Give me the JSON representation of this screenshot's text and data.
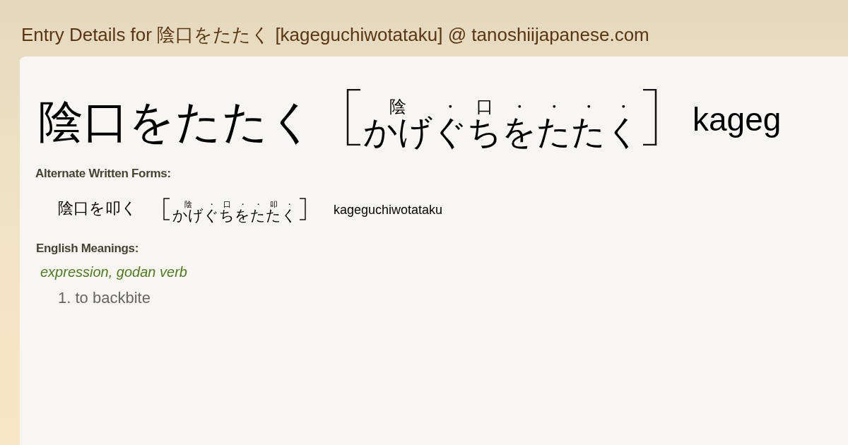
{
  "page_title": "Entry Details for 陰口をたたく [kageguchiwotataku] @ tanoshiijapanese.com",
  "entry": {
    "word": "陰口をたたく",
    "reading": [
      {
        "ruby": "陰",
        "kana": "かげ"
      },
      {
        "ruby": "・",
        "kana": "ぐ"
      },
      {
        "ruby": "口",
        "kana": "ち"
      },
      {
        "ruby": "・",
        "kana": "を"
      },
      {
        "ruby": "・",
        "kana": "た"
      },
      {
        "ruby": "・",
        "kana": "た"
      },
      {
        "ruby": "・",
        "kana": "く"
      }
    ],
    "romaji": "kageg"
  },
  "alternate_forms": {
    "heading": "Alternate Written Forms:",
    "items": [
      {
        "word": "陰口を叩く",
        "reading": [
          {
            "ruby": "陰",
            "kana": "かげ"
          },
          {
            "ruby": "・",
            "kana": "ぐ"
          },
          {
            "ruby": "口",
            "kana": "ち"
          },
          {
            "ruby": "・",
            "kana": "を"
          },
          {
            "ruby": "・",
            "kana": "た"
          },
          {
            "ruby": "叩",
            "kana": "た"
          },
          {
            "ruby": "・",
            "kana": "く"
          }
        ],
        "romaji": "kageguchiwotataku"
      }
    ]
  },
  "meanings": {
    "heading": "English Meanings:",
    "groups": [
      {
        "pos": "expression, godan verb",
        "senses": [
          "1. to backbite"
        ]
      }
    ]
  }
}
